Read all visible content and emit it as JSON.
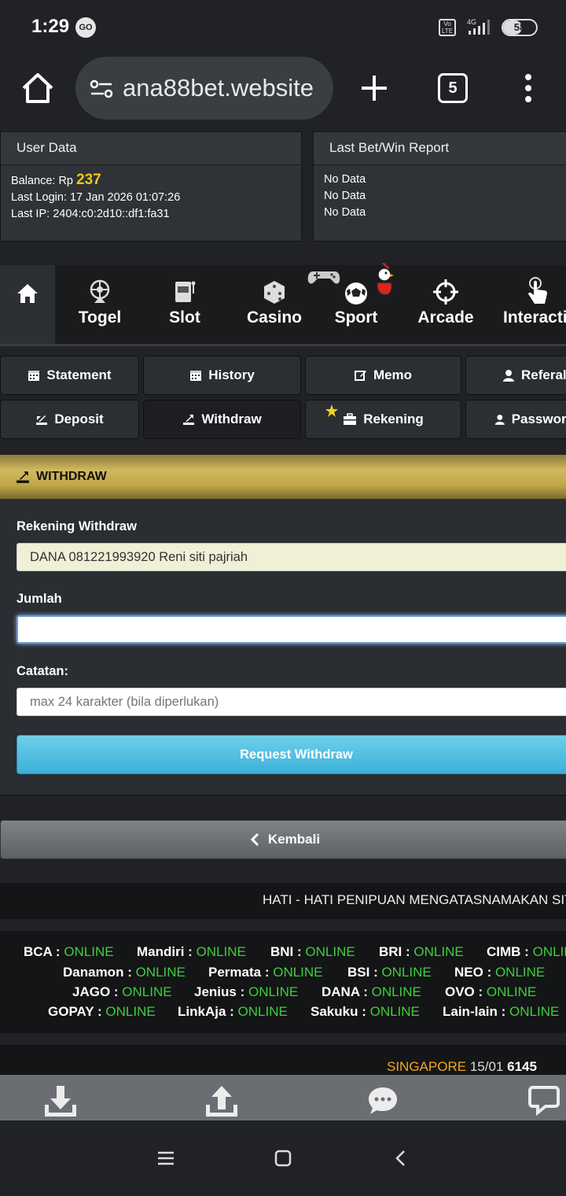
{
  "status_bar": {
    "time": "1:29",
    "go_badge": "GO",
    "volte": "Vo\nLTE",
    "network": "4G",
    "battery": "58",
    "battery_level": 0.58
  },
  "browser": {
    "url": "ana88bet.website",
    "tab_count": "5"
  },
  "user_data": {
    "title": "User Data",
    "balance_label": "Balance: Rp ",
    "balance_value": "237",
    "last_login": "Last Login: 17 Jan 2026 01:07:26",
    "last_ip": "Last IP: 2404:c0:2d10::df1:fa31"
  },
  "bet_report": {
    "title": "Last Bet/Win Report",
    "rows": [
      "No Data",
      "No Data",
      "No Data"
    ]
  },
  "categories": [
    "Togel",
    "Slot",
    "Casino",
    "Sport",
    "Arcade",
    "Interactive"
  ],
  "actions": {
    "statement": "Statement",
    "history": "History",
    "memo": "Memo",
    "referal": "Referal",
    "deposit": "Deposit",
    "withdraw": "Withdraw",
    "rekening": "Rekening",
    "password": "Password"
  },
  "withdraw": {
    "title": "WITHDRAW",
    "rekening_label": "Rekening Withdraw",
    "rekening_value": "DANA 081221993920 Reni siti pajriah",
    "jumlah_label": "Jumlah",
    "jumlah_value": "",
    "catatan_label": "Catatan:",
    "catatan_placeholder": "max 24 karakter (bila diperlukan)",
    "submit_label": "Request Withdraw"
  },
  "back_label": "Kembali",
  "marquee": "HATI - HATI PENIPUAN MENGATASNAMAKAN SITUS",
  "banks": [
    {
      "name": "BCA",
      "status": "ONLINE"
    },
    {
      "name": "Mandiri",
      "status": "ONLINE"
    },
    {
      "name": "BNI",
      "status": "ONLINE"
    },
    {
      "name": "BRI",
      "status": "ONLINE"
    },
    {
      "name": "CIMB",
      "status": "ONLINE"
    },
    {
      "name": "Danamon",
      "status": "ONLINE"
    },
    {
      "name": "Permata",
      "status": "ONLINE"
    },
    {
      "name": "BSI",
      "status": "ONLINE"
    },
    {
      "name": "NEO",
      "status": "ONLINE"
    },
    {
      "name": "JAGO",
      "status": "ONLINE"
    },
    {
      "name": "Jenius",
      "status": "ONLINE"
    },
    {
      "name": "DANA",
      "status": "ONLINE"
    },
    {
      "name": "OVO",
      "status": "ONLINE"
    },
    {
      "name": "GOPAY",
      "status": "ONLINE"
    },
    {
      "name": "LinkAja",
      "status": "ONLINE"
    },
    {
      "name": "Sakuku",
      "status": "ONLINE"
    },
    {
      "name": "Lain-lain",
      "status": "ONLINE"
    }
  ],
  "bank_separator": " : ",
  "result": {
    "market": "SINGAPORE",
    "date": "15/01",
    "number": "6145"
  },
  "colors": {
    "online": "#3ecf3e",
    "balance": "#f5c518",
    "header_gold": "#d2b95e",
    "button_blue": "#4dbfe0"
  }
}
